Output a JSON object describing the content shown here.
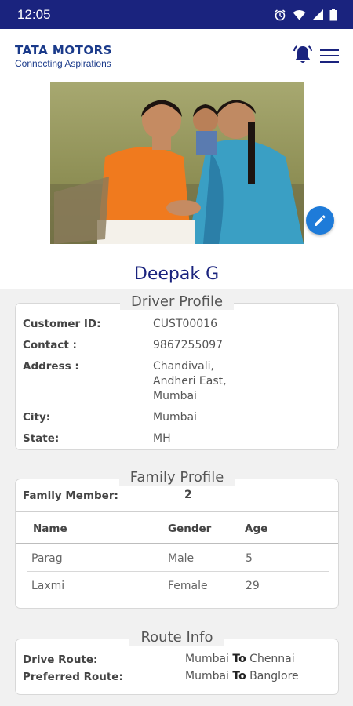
{
  "status_bar": {
    "time": "12:05"
  },
  "brand": {
    "name": "TATA MOTORS",
    "tagline": "Connecting Aspirations"
  },
  "profile": {
    "name": "Deepak G"
  },
  "driver_profile": {
    "title": "Driver Profile",
    "customer_id_label": "Customer ID:",
    "customer_id": "CUST00016",
    "contact_label": "Contact :",
    "contact": "9867255097",
    "address_label": "Address :",
    "address_lines": [
      "Chandivali,",
      "Andheri East,",
      "Mumbai"
    ],
    "city_label": "City:",
    "city": "Mumbai",
    "state_label": "State:",
    "state": "MH"
  },
  "family_profile": {
    "title": "Family Profile",
    "family_member_label": "Family Member:",
    "family_member_count": "2",
    "columns": [
      "Name",
      "Gender",
      "Age"
    ],
    "rows": [
      {
        "name": "Parag",
        "gender": "Male",
        "age": "5"
      },
      {
        "name": "Laxmi",
        "gender": "Female",
        "age": "29"
      }
    ]
  },
  "route_info": {
    "title": "Route Info",
    "drive_route_label": "Drive Route:",
    "drive_from": "Mumbai",
    "drive_to": "Chennai",
    "preferred_route_label": "Preferred Route:",
    "preferred_from": "Mumbai",
    "preferred_to": "Banglore",
    "to_word": "To"
  },
  "colors": {
    "status_bar": "#1a237e",
    "accent": "#1a237e",
    "edit_button": "#1e7bd9"
  },
  "icons": [
    "alarm-icon",
    "wifi-icon",
    "signal-icon",
    "battery-icon",
    "bell-icon",
    "menu-icon",
    "edit-pencil-icon"
  ]
}
